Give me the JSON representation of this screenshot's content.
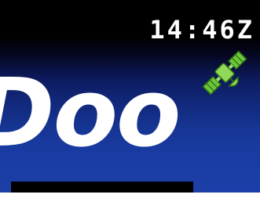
{
  "status_bar": {
    "utc_time": "14:46Z"
  },
  "icons": {
    "gps_status": "satellite-icon"
  },
  "splash": {
    "logo_text": "Doo"
  },
  "colors": {
    "background_top": "#000000",
    "background_bottom": "#1b3ea8",
    "satellite_green": "#6cc63a",
    "text": "#ffffff"
  }
}
